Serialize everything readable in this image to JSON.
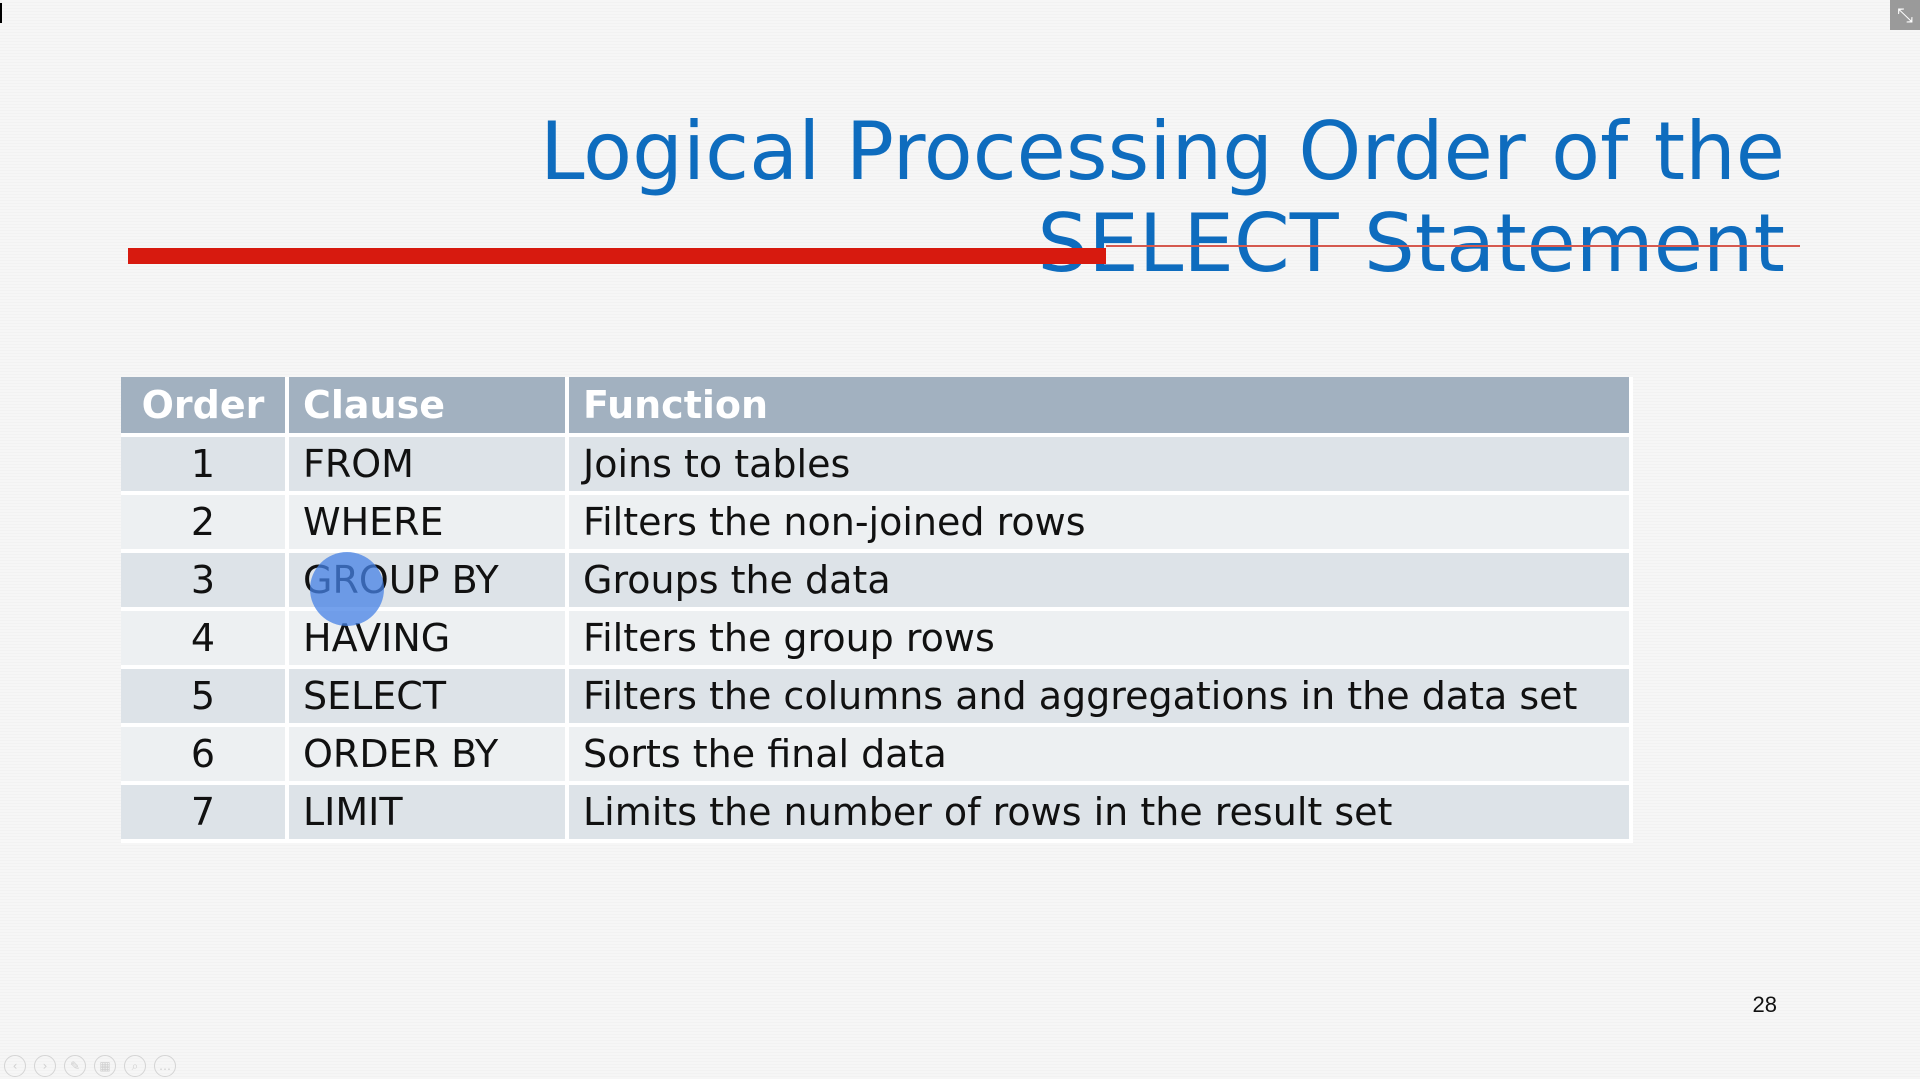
{
  "slide": {
    "title_line1": "Logical Processing Order of the",
    "title_line2": "SELECT Statement",
    "page_number": "28"
  },
  "table": {
    "headers": [
      "Order",
      "Clause",
      "Function"
    ],
    "rows": [
      {
        "order": "1",
        "clause": "FROM",
        "function": "Joins to tables"
      },
      {
        "order": "2",
        "clause": "WHERE",
        "function": "Filters the non-joined rows"
      },
      {
        "order": "3",
        "clause": "GROUP BY",
        "function": "Groups the data"
      },
      {
        "order": "4",
        "clause": "HAVING",
        "function": "Filters the group rows"
      },
      {
        "order": "5",
        "clause": "SELECT",
        "function": "Filters the columns and aggregations in the data set"
      },
      {
        "order": "6",
        "clause": "ORDER BY",
        "function": "Sorts the final data"
      },
      {
        "order": "7",
        "clause": "LIMIT",
        "function": "Limits the number of rows in the result set"
      }
    ]
  },
  "colors": {
    "title": "#0e6cbe",
    "accent_rule": "#d71a0f",
    "header_bg": "#a2b1c0",
    "pointer": "#4682e6"
  },
  "controls": {
    "exit_icon": "exit-fullscreen-icon",
    "nav_icons": [
      "prev-icon",
      "next-icon",
      "pen-icon",
      "slides-icon",
      "zoom-icon",
      "more-icon"
    ]
  }
}
